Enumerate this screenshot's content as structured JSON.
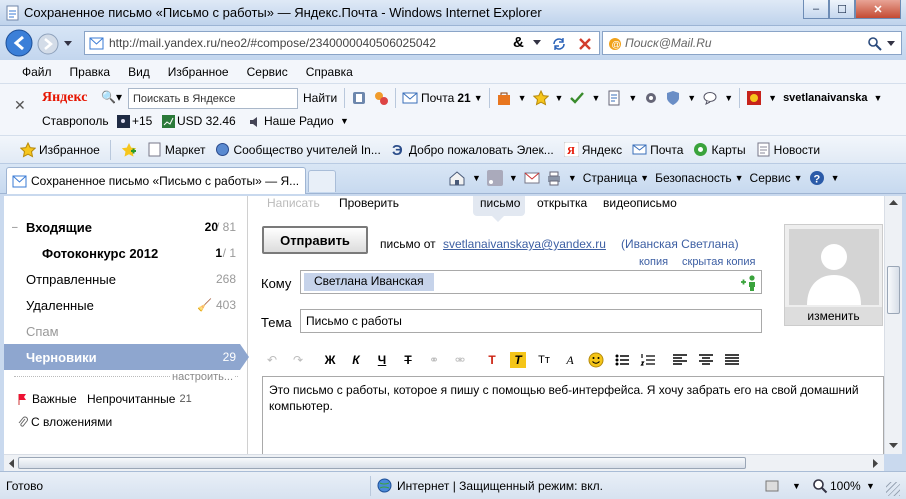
{
  "window": {
    "title": "Сохраненное письмо «Письмо с работы» — Яндекс.Почта - Windows Internet Explorer",
    "url": "http://mail.yandex.ru/neo2/#compose/2340000040506025042",
    "search_placeholder": "Поиск@Mail.Ru"
  },
  "menu": [
    "Файл",
    "Правка",
    "Вид",
    "Избранное",
    "Сервис",
    "Справка"
  ],
  "yandex_bar": {
    "logo": "Яндекс",
    "search_placeholder": "Поискать в Яндексе",
    "find": "Найти",
    "mail_label": "Почта",
    "mail_count": "21",
    "user": "svetlanaivanska",
    "city": "Ставрополь",
    "temp": "+15",
    "usd": "USD 32.46",
    "radio": "Наше Радио"
  },
  "favorites": {
    "label": "Избранное",
    "links": [
      "Маркет",
      "Сообщество учителей In...",
      "Добро пожаловать Элек...",
      "Яндекс",
      "Почта",
      "Карты",
      "Новости"
    ]
  },
  "tab": {
    "title": "Сохраненное письмо «Письмо с работы» — Я..."
  },
  "command_bar": [
    "Страница",
    "Безопасность",
    "Сервис"
  ],
  "folders": [
    {
      "name": "Входящие",
      "unread": "20",
      "total": "/ 81"
    },
    {
      "name": "Фотоконкурс 2012",
      "unread": "1",
      "total": "/ 1"
    },
    {
      "name": "Отправленные",
      "count": "268"
    },
    {
      "name": "Удаленные",
      "count": "403"
    },
    {
      "name": "Спам"
    },
    {
      "name": "Черновики",
      "count": "29"
    }
  ],
  "configure": "настроить...",
  "labels": {
    "important": "Важные",
    "unread": "Непрочитанные",
    "unread_count": "21",
    "attachments": "С вложениями"
  },
  "compose": {
    "top_links": [
      "Написать",
      "Проверить"
    ],
    "modes": [
      "письмо",
      "открытка",
      "видеописьмо"
    ],
    "send_button": "Отправить",
    "from_label": "письмо от",
    "from_email": "svetlanaivanskaya@yandex.ru",
    "from_name": "(Иванская Светлана)",
    "copy": "копия",
    "bcc": "скрытая копия",
    "to_label": "Кому",
    "to_value": "Светлана Иванская",
    "subject_label": "Тема",
    "subject_value": "Письмо с работы",
    "body": "Это письмо с работы, которое я пишу с помощью веб-интерфейса. Я хочу забрать его на свой домашний компьютер.",
    "change_avatar": "изменить"
  },
  "status": {
    "left": "Готово",
    "zone": "Интернет | Защищенный режим: вкл.",
    "zoom": "100%"
  }
}
